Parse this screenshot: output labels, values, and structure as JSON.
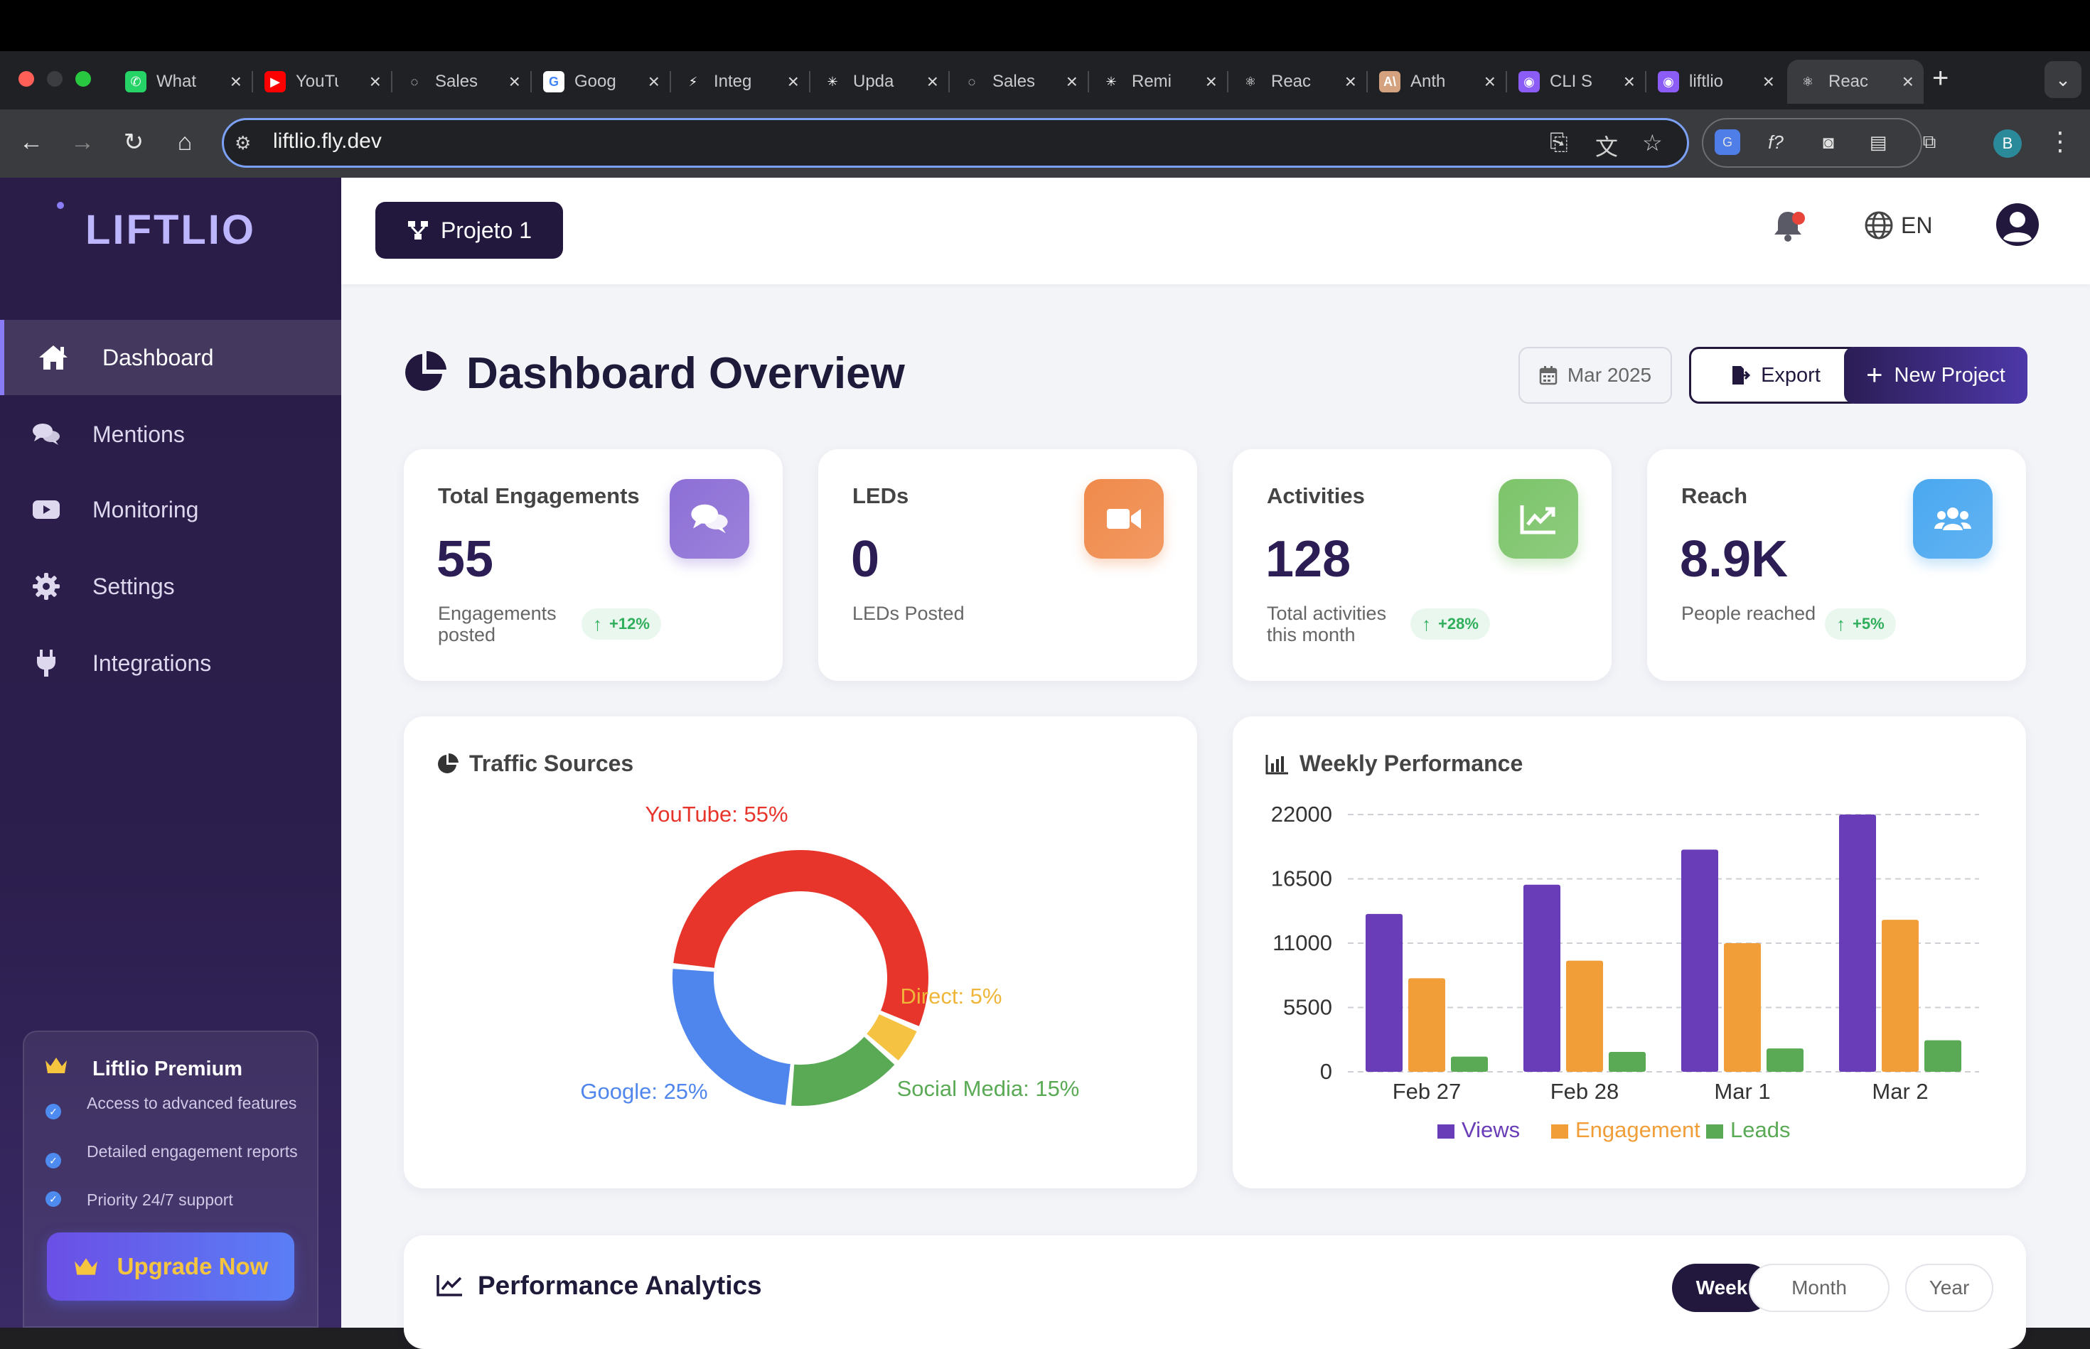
{
  "browser": {
    "tabs": [
      {
        "title": "What",
        "fav_color": "#25d366",
        "fav_glyph": "✆"
      },
      {
        "title": "YouTu",
        "fav_color": "#ff0000",
        "fav_glyph": "▶"
      },
      {
        "title": "Sales",
        "fav_color": "#202124",
        "fav_glyph": "◌"
      },
      {
        "title": "Goog",
        "fav_color": "#ffffff",
        "fav_glyph": "G"
      },
      {
        "title": "Integ",
        "fav_color": "#202124",
        "fav_glyph": "⚡"
      },
      {
        "title": "Upda",
        "fav_color": "#202124",
        "fav_glyph": "✳"
      },
      {
        "title": "Sales",
        "fav_color": "#202124",
        "fav_glyph": "◌"
      },
      {
        "title": "Remi",
        "fav_color": "#202124",
        "fav_glyph": "✳"
      },
      {
        "title": "Reac",
        "fav_color": "#202124",
        "fav_glyph": "⚛"
      },
      {
        "title": "Anth",
        "fav_color": "#d4a27f",
        "fav_glyph": "A\\"
      },
      {
        "title": "CLI S",
        "fav_color": "#8b5cf6",
        "fav_glyph": "◉"
      },
      {
        "title": "liftlio",
        "fav_color": "#8b5cf6",
        "fav_glyph": "◉"
      },
      {
        "title": "Reac",
        "fav_color": "#3a3b3f",
        "fav_glyph": "⚛"
      }
    ],
    "url": "liftlio.fly.dev",
    "profile_initial": "B"
  },
  "sidebar": {
    "logo": "LIFTLIO",
    "items": [
      {
        "label": "Dashboard",
        "icon": "home-icon",
        "active": true
      },
      {
        "label": "Mentions",
        "icon": "comments-icon",
        "active": false
      },
      {
        "label": "Monitoring",
        "icon": "youtube-icon",
        "active": false
      },
      {
        "label": "Settings",
        "icon": "gear-icon",
        "active": false
      },
      {
        "label": "Integrations",
        "icon": "plug-icon",
        "active": false
      }
    ],
    "premium": {
      "title": "Liftlio Premium",
      "features": [
        "Access to advanced features",
        "Detailed engagement reports",
        "Priority 24/7 support"
      ],
      "cta": "Upgrade Now"
    }
  },
  "header": {
    "project_label": "Projeto 1",
    "language": "EN"
  },
  "dashboard": {
    "title": "Dashboard Overview",
    "date": "Mar 2025",
    "export_label": "Export",
    "new_project_label": "New Project"
  },
  "stats": [
    {
      "title": "Total Engagements",
      "value": "55",
      "sub": "Engagements posted",
      "badge": "+12%",
      "icon": "comments-icon",
      "color": "#8d6fd6"
    },
    {
      "title": "LEDs",
      "value": "0",
      "sub": "LEDs Posted",
      "badge": "",
      "icon": "video-icon",
      "color": "#f08a4b"
    },
    {
      "title": "Activities",
      "value": "128",
      "sub": "Total activities this month",
      "badge": "+28%",
      "icon": "chart-line-icon",
      "color": "#7cc46a"
    },
    {
      "title": "Reach",
      "value": "8.9K",
      "sub": "People reached",
      "badge": "+5%",
      "icon": "users-icon",
      "color": "#4aa8f0"
    }
  ],
  "traffic": {
    "title": "Traffic Sources"
  },
  "weekly": {
    "title": "Weekly Performance"
  },
  "analytics": {
    "title": "Performance Analytics",
    "ranges": [
      {
        "label": "Week",
        "active": true
      },
      {
        "label": "Month",
        "active": false
      },
      {
        "label": "Year",
        "active": false
      }
    ]
  },
  "chart_data": [
    {
      "type": "pie",
      "donut": true,
      "title": "Traffic Sources",
      "slices": [
        {
          "label": "YouTube: 55%",
          "name": "YouTube",
          "value": 55,
          "color": "#e8352b"
        },
        {
          "label": "Direct: 5%",
          "name": "Direct",
          "value": 5,
          "color": "#f5c242"
        },
        {
          "label": "Social Media: 15%",
          "name": "Social Media",
          "value": 15,
          "color": "#5aaa55"
        },
        {
          "label": "Google: 25%",
          "name": "Google",
          "value": 25,
          "color": "#4f86ee"
        }
      ]
    },
    {
      "type": "bar",
      "title": "Weekly Performance",
      "categories": [
        "Feb 27",
        "Feb 28",
        "Mar 1",
        "Mar 2"
      ],
      "series": [
        {
          "name": "Views",
          "color": "#6a3db8",
          "values": [
            13500,
            16000,
            19000,
            22000
          ]
        },
        {
          "name": "Engagement",
          "color": "#f19e38",
          "values": [
            8000,
            9500,
            11000,
            13000
          ]
        },
        {
          "name": "Leads",
          "color": "#5aaa55",
          "values": [
            1300,
            1700,
            2000,
            2700
          ]
        }
      ],
      "yticks": [
        "22000",
        "16500",
        "11000",
        "5500",
        "0"
      ],
      "ylim": [
        0,
        22000
      ],
      "grid": true,
      "legend": "bottom"
    }
  ]
}
